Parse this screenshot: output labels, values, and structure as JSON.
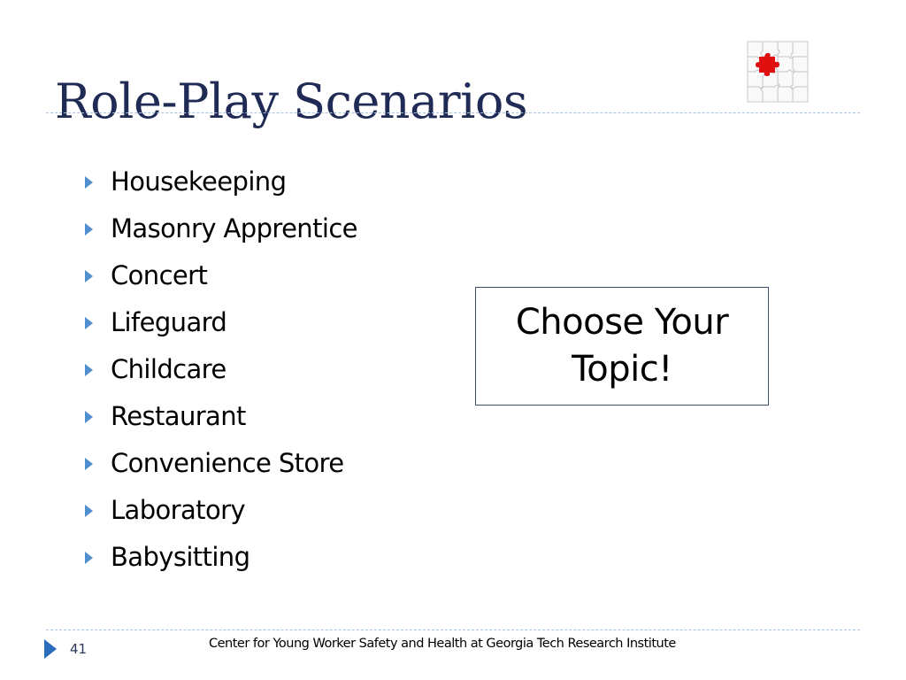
{
  "slide": {
    "title": "Role-Play Scenarios",
    "puzzle_icon": "puzzle-icon",
    "bullets": [
      {
        "label": "Housekeeping",
        "icon": "triangle-bullet-icon"
      },
      {
        "label": "Masonry Apprentice",
        "icon": "triangle-bullet-icon"
      },
      {
        "label": "Concert",
        "icon": "triangle-bullet-icon"
      },
      {
        "label": "Lifeguard",
        "icon": "triangle-bullet-icon"
      },
      {
        "label": "Childcare",
        "icon": "triangle-bullet-icon"
      },
      {
        "label": "Restaurant",
        "icon": "triangle-bullet-icon"
      },
      {
        "label": "Convenience Store",
        "icon": "triangle-bullet-icon"
      },
      {
        "label": "Laboratory",
        "icon": "triangle-bullet-icon"
      },
      {
        "label": "Babysitting",
        "icon": "triangle-bullet-icon"
      }
    ],
    "callout": "Choose Your Topic!"
  },
  "footer": {
    "page_number": "41",
    "text": "Center for Young Worker Safety and Health at Georgia Tech Research Institute"
  },
  "colors": {
    "title": "#1f2a55",
    "bullet": "#4f8fd0",
    "rule": "#a9c3de",
    "accent_piece": "#e01010"
  }
}
